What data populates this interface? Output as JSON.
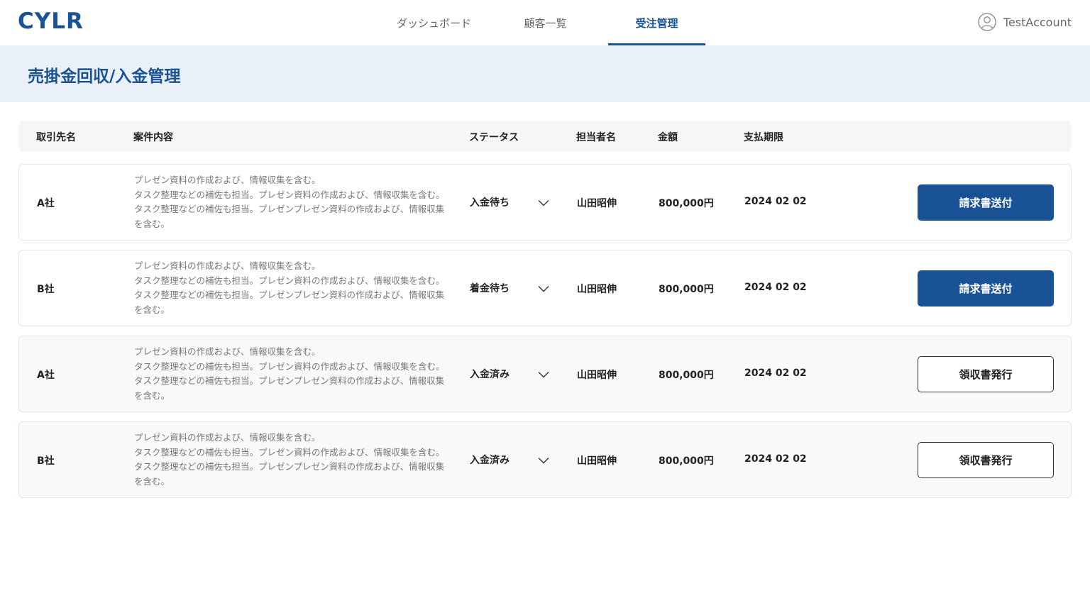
{
  "header": {
    "logo": "CYLR",
    "nav": [
      {
        "label": "ダッシュボード"
      },
      {
        "label": "顧客一覧"
      },
      {
        "label": "受注管理"
      }
    ],
    "account_name": "TestAccount"
  },
  "page": {
    "title": "売掛金回収/入金管理"
  },
  "table": {
    "headers": {
      "company": "取引先名",
      "content": "案件内容",
      "status": "ステータス",
      "person": "担当者名",
      "amount": "金額",
      "due": "支払期限"
    },
    "rows": [
      {
        "company": "A社",
        "desc": "プレゼン資料の作成および、情報収集を含む。\nタスク整理などの補佐も担当。プレゼン資料の作成および、情報収集を含む。タスク整理などの補佐も担当。プレゼンプレゼン資料の作成および、情報収集を含む。",
        "status": "入金待ち",
        "person": "山田昭伸",
        "amount": "800,000円",
        "due": "2024 02 02",
        "action": "請求書送付"
      },
      {
        "company": "B社",
        "desc": "プレゼン資料の作成および、情報収集を含む。\nタスク整理などの補佐も担当。プレゼン資料の作成および、情報収集を含む。タスク整理などの補佐も担当。プレゼンプレゼン資料の作成および、情報収集を含む。",
        "status": "着金待ち",
        "person": "山田昭伸",
        "amount": "800,000円",
        "due": "2024 02 02",
        "action": "請求書送付"
      },
      {
        "company": "A社",
        "desc": "プレゼン資料の作成および、情報収集を含む。\nタスク整理などの補佐も担当。プレゼン資料の作成および、情報収集を含む。タスク整理などの補佐も担当。プレゼンプレゼン資料の作成および、情報収集を含む。",
        "status": "入金済み",
        "person": "山田昭伸",
        "amount": "800,000円",
        "due": "2024 02 02",
        "action": "領収書発行"
      },
      {
        "company": "B社",
        "desc": "プレゼン資料の作成および、情報収集を含む。\nタスク整理などの補佐も担当。プレゼン資料の作成および、情報収集を含む。タスク整理などの補佐も担当。プレゼンプレゼン資料の作成および、情報収集を含む。",
        "status": "入金済み",
        "person": "山田昭伸",
        "amount": "800,000円",
        "due": "2024 02 02",
        "action": "領収書発行"
      }
    ]
  },
  "colors": {
    "primary": "#1a5395",
    "title_bar_bg": "#eaf0f8"
  },
  "icons": {
    "account": "user-circle-icon",
    "status_dropdown": "chevron-down-icon"
  }
}
